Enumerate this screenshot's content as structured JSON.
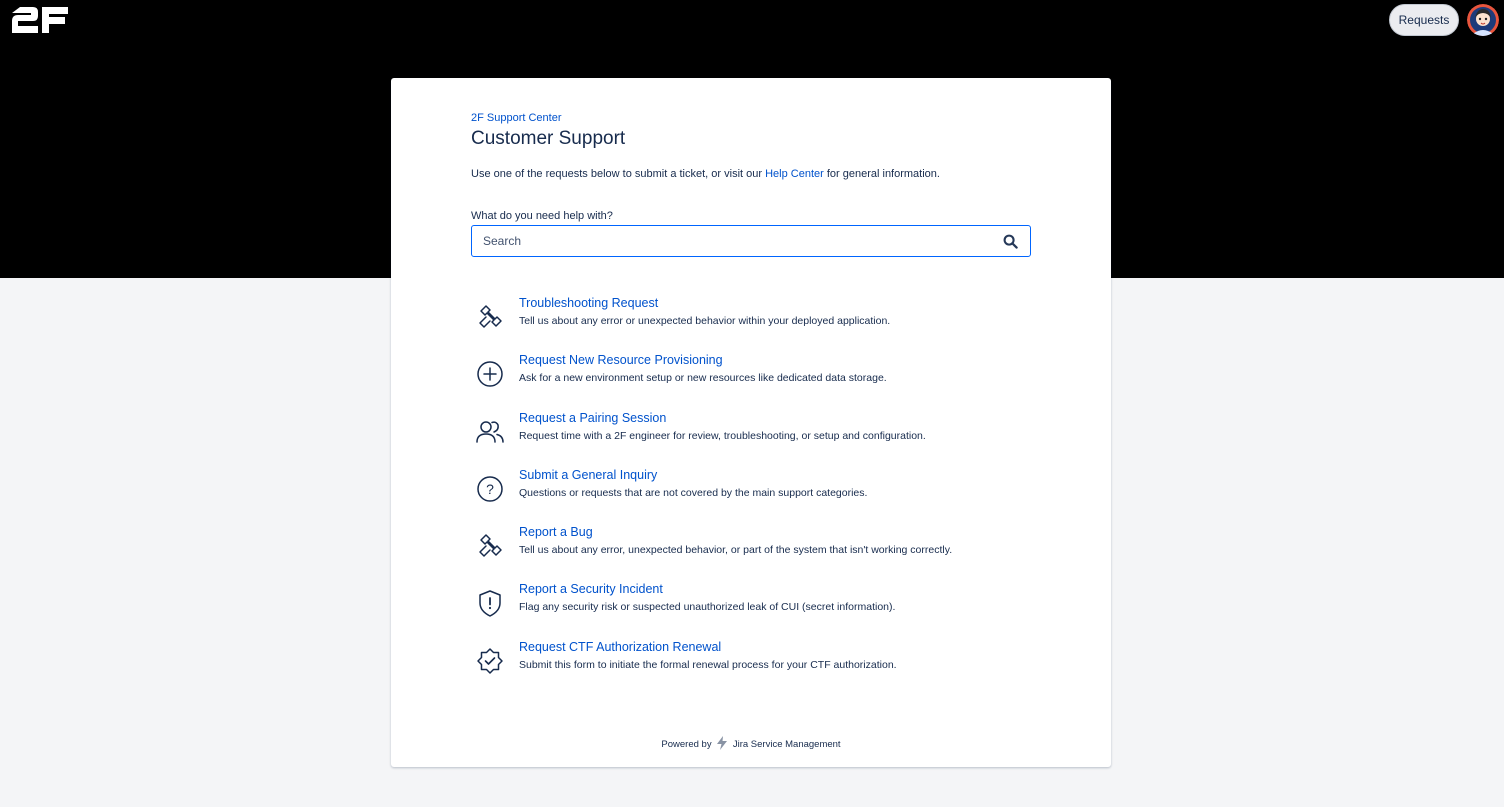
{
  "header": {
    "logo_text": "2F",
    "requests_label": "Requests"
  },
  "portal": {
    "breadcrumb": "2F Support Center",
    "title": "Customer Support",
    "intro_before": "Use one of the requests below to submit a ticket, or visit our ",
    "intro_link": "Help Center",
    "intro_after": " for general information."
  },
  "search": {
    "label": "What do you need help with?",
    "placeholder": "Search",
    "value": ""
  },
  "request_types": [
    {
      "icon": "wrench-icon",
      "title": "Troubleshooting Request",
      "description": "Tell us about any error or unexpected behavior within your deployed application."
    },
    {
      "icon": "plus-circle-icon",
      "title": "Request New Resource Provisioning",
      "description": "Ask for a new environment setup or new resources like dedicated data storage."
    },
    {
      "icon": "people-icon",
      "title": "Request a Pairing Session",
      "description": "Request time with a 2F engineer for review, troubleshooting, or setup and configuration."
    },
    {
      "icon": "question-circle-icon",
      "title": "Submit a General Inquiry",
      "description": "Questions or requests that are not covered by the main support categories."
    },
    {
      "icon": "wrench-icon",
      "title": "Report a Bug",
      "description": "Tell us about any error, unexpected behavior, or part of the system that isn't working correctly."
    },
    {
      "icon": "shield-alert-icon",
      "title": "Report a Security Incident",
      "description": "Flag any security risk or suspected unauthorized leak of CUI (secret information)."
    },
    {
      "icon": "badge-check-icon",
      "title": "Request CTF Authorization Renewal",
      "description": "Submit this form to initiate the formal renewal process for your CTF authorization."
    }
  ],
  "footer": {
    "powered_by": "Powered by",
    "product": "Jira Service Management"
  },
  "colors": {
    "header_bg": "#000000",
    "page_bg": "#f4f5f7",
    "link": "#0052cc",
    "text": "#172b4d",
    "focus_border": "#0065ff"
  }
}
